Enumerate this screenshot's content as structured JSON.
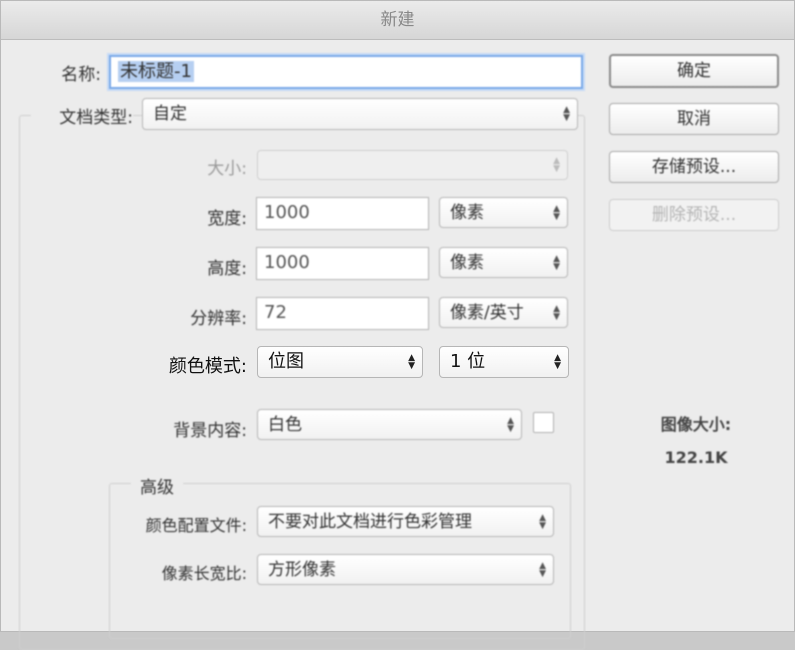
{
  "dialog": {
    "title": "新建",
    "name_label": "名称:",
    "name_value": "未标题-1",
    "doc_type_label": "文档类型:",
    "doc_type_value": "自定",
    "size_label": "大小:",
    "size_value": "",
    "width_label": "宽度:",
    "width_value": "1000",
    "width_unit": "像素",
    "height_label": "高度:",
    "height_value": "1000",
    "height_unit": "像素",
    "resolution_label": "分辨率:",
    "resolution_value": "72",
    "resolution_unit": "像素/英寸",
    "color_mode_label": "颜色模式:",
    "color_mode_value": "位图",
    "bit_depth_value": "1 位",
    "background_label": "背景内容:",
    "background_value": "白色",
    "background_swatch_color": "#ffffff",
    "advanced_label": "高级",
    "color_profile_label": "颜色配置文件:",
    "color_profile_value": "不要对此文档进行色彩管理",
    "pixel_aspect_label": "像素长宽比:",
    "pixel_aspect_value": "方形像素"
  },
  "buttons": {
    "ok": "确定",
    "cancel": "取消",
    "save_preset": "存储预设...",
    "delete_preset": "删除预设..."
  },
  "image_size": {
    "label": "图像大小:",
    "value": "122.1K"
  },
  "colors": {
    "focus_ring": "#7aa9e8",
    "selection": "#b6cff1",
    "window_bg": "#ececec"
  }
}
